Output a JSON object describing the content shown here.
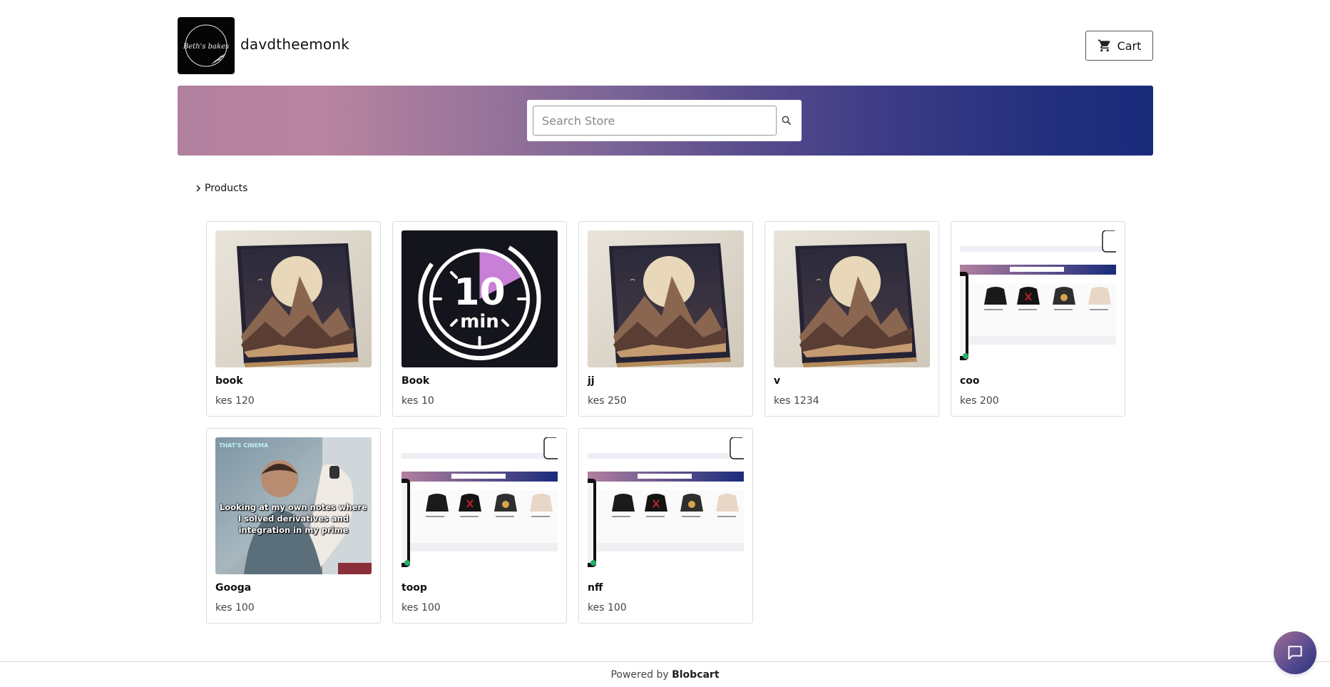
{
  "store": {
    "name": "davdtheemonk",
    "logo_text": "Beth's bakes"
  },
  "header": {
    "cart_label": "Cart",
    "cart_icon": "shopping-cart-icon"
  },
  "search": {
    "placeholder": "Search Store",
    "icon": "search-icon"
  },
  "breadcrumb": {
    "label": "Products",
    "icon": "chevron-right-icon"
  },
  "products": [
    {
      "name": "book",
      "price": "kes 120",
      "image": "book-cover"
    },
    {
      "name": "Book",
      "price": "kes 10",
      "image": "ten-min-timer"
    },
    {
      "name": "jj",
      "price": "kes 250",
      "image": "book-cover"
    },
    {
      "name": "v",
      "price": "kes 1234",
      "image": "book-cover"
    },
    {
      "name": "coo",
      "price": "kes 200",
      "image": "store-screenshot"
    },
    {
      "name": "Googa",
      "price": "kes 100",
      "image": "meme-photo"
    },
    {
      "name": "toop",
      "price": "kes 100",
      "image": "store-screenshot"
    },
    {
      "name": "nff",
      "price": "kes 100",
      "image": "store-screenshot"
    }
  ],
  "timer_image": {
    "number": "10",
    "unit": "min"
  },
  "meme_image": {
    "badge": "THAT'S CINEMA",
    "caption": "Looking at my own notes where I solved derivatives and integration in my prime"
  },
  "footer": {
    "prefix": "Powered by",
    "brand": "Blobcart"
  },
  "chat": {
    "icon": "chat-bubble-icon"
  },
  "colors": {
    "banner_start": "#b2809f",
    "banner_end": "#1a2b7b",
    "timer_accent": "#c87fd6"
  }
}
